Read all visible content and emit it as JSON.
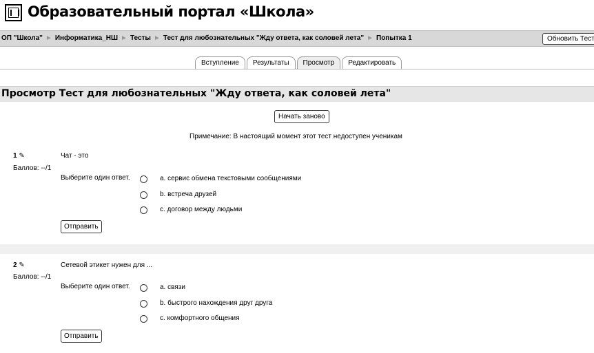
{
  "header": {
    "title": "Образовательный портал «Школа»",
    "logo_icon": "building-columns-icon"
  },
  "breadcrumb": {
    "items": [
      "ОП \"Школа\"",
      "Информатика_НШ",
      "Тесты",
      "Тест для любознательных \"Жду ответа, как соловей лета\"",
      "Попытка 1"
    ],
    "separator": "►",
    "refresh_label": "Обновить Тест"
  },
  "tabs": [
    "Вступление",
    "Результаты",
    "Просмотр",
    "Редактировать"
  ],
  "active_tab": "Просмотр",
  "page": {
    "heading": "Просмотр Тест для любознательных \"Жду ответа, как соловей лета\"",
    "restart_label": "Начать заново",
    "note": "Примечание: В настоящий момент этот тест недоступен ученикам"
  },
  "questions": [
    {
      "number": "1",
      "edit_icon": "pencil-icon",
      "grade": "Баллов: --/1",
      "text": "Чат - это",
      "prompt": "Выберите один ответ.",
      "options": [
        "a. сервис обмена текстовыми сообщениями",
        "b. встреча друзей",
        "c. договор между людьми"
      ],
      "submit_label": "Отправить"
    },
    {
      "number": "2",
      "edit_icon": "pencil-icon",
      "grade": "Баллов: --/1",
      "text": "Сетевой этикет нужен для ...",
      "prompt": "Выберите один ответ.",
      "options": [
        "a. связи",
        "b. быстрого нахождения друг друга",
        "c. комфортного общения"
      ],
      "submit_label": "Отправить"
    }
  ]
}
